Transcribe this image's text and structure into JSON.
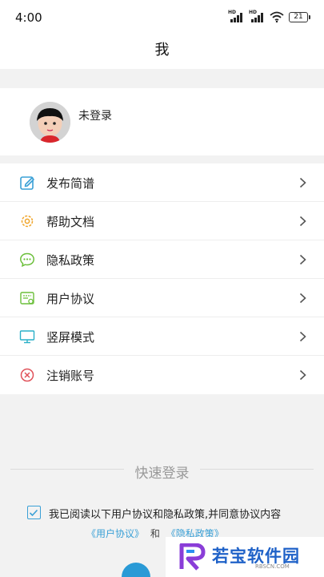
{
  "status_bar": {
    "time": "4:00",
    "battery": "21"
  },
  "header": {
    "title": "我"
  },
  "user": {
    "name": "未登录"
  },
  "menu": [
    {
      "label": "发布简谱",
      "icon": "edit-icon"
    },
    {
      "label": "帮助文档",
      "icon": "gear-icon"
    },
    {
      "label": "隐私政策",
      "icon": "chat-bubble-icon"
    },
    {
      "label": "用户协议",
      "icon": "agreement-icon"
    },
    {
      "label": "竖屏模式",
      "icon": "monitor-icon"
    },
    {
      "label": "注销账号",
      "icon": "cancel-circle-icon"
    }
  ],
  "quick_login": {
    "title": "快速登录",
    "agreement_text": "我已阅读以下用户协议和隐私政策,并同意协议内容",
    "user_agreement_link": "《用户协议》",
    "and": "和",
    "privacy_link": "《隐私政策》"
  },
  "watermark": {
    "text": "若宝软件园",
    "sub": "RBSCN.COM"
  },
  "colors": {
    "accent": "#3aa0d6",
    "background": "#f2f2f2",
    "card": "#ffffff"
  }
}
